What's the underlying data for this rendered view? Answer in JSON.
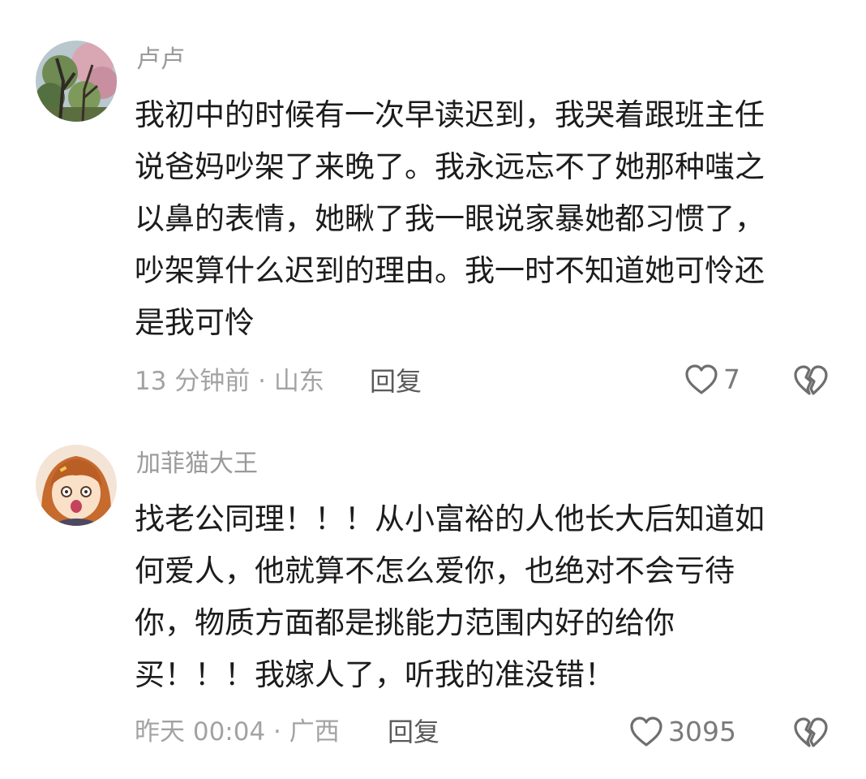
{
  "comments": [
    {
      "username": "卢卢",
      "lines": [
        "我初中的时候有一次早读迟到，我哭着跟班主任",
        "说爸妈吵架了来晚了。我永远忘不了她那种嗤之",
        "以鼻的表情，她瞅了我一眼说家暴她都习惯了，",
        "吵架算什么迟到的理由。我一时不知道她可怜还",
        "是我可怜"
      ],
      "meta": "13 分钟前 · 山东",
      "reply_label": "回复",
      "like_count": "7",
      "avatar_icon": "tree-blossom-avatar"
    },
    {
      "username": "加菲猫大王",
      "lines": [
        "找老公同理！！！从小富裕的人他长大后知道如",
        "何爱人，他就算不怎么爱你，也绝对不会亏待",
        "你，物质方面都是挑能力范围内好的给你",
        "买！！！我嫁人了，听我的准没错！"
      ],
      "meta": "昨天 00:04 · 广西",
      "reply_label": "回复",
      "like_count": "3095",
      "avatar_icon": "anime-girl-avatar"
    }
  ],
  "colors": {
    "username": "#9a9a9a",
    "body": "#1c1c1c",
    "meta": "#a3a3a3",
    "reply": "#5a5a5a",
    "icon": "#6e6e6e"
  },
  "icons": {
    "like": "heart-outline-icon",
    "dislike": "broken-heart-icon"
  }
}
